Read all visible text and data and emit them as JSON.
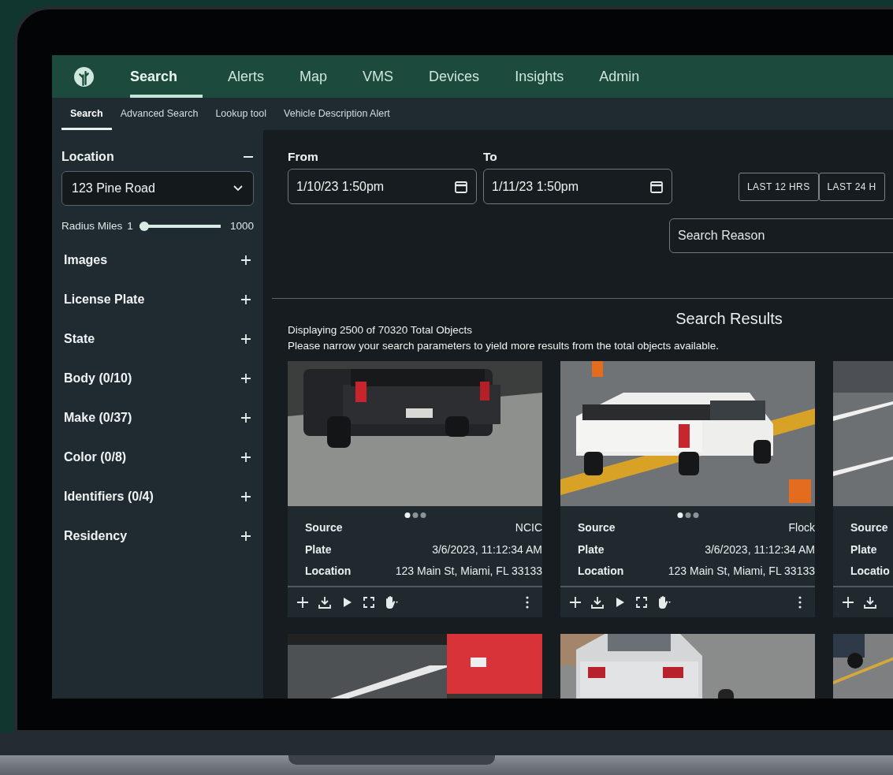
{
  "nav": {
    "tabs": [
      {
        "label": "Search",
        "selected": true
      },
      {
        "label": "Alerts",
        "selected": false
      },
      {
        "label": "Map",
        "selected": false
      },
      {
        "label": "VMS",
        "selected": false
      },
      {
        "label": "Devices",
        "selected": false
      },
      {
        "label": "Insights",
        "selected": false
      },
      {
        "label": "Admin",
        "selected": false
      }
    ]
  },
  "subnav": {
    "tabs": [
      {
        "label": "Search",
        "selected": true
      },
      {
        "label": "Advanced Search",
        "selected": false
      },
      {
        "label": "Lookup tool",
        "selected": false
      },
      {
        "label": "Vehicle Description Alert",
        "selected": false
      }
    ]
  },
  "sidebar": {
    "location": {
      "label": "Location",
      "expanded": true,
      "value": "123 Pine Road"
    },
    "radius": {
      "label": "Radius Miles",
      "min": "1",
      "max": "1000",
      "level": 0
    },
    "filters": [
      {
        "label": "Images",
        "expanded": false
      },
      {
        "label": "License Plate",
        "expanded": false
      },
      {
        "label": "State",
        "expanded": false
      },
      {
        "label": "Body (0/10)",
        "expanded": false
      },
      {
        "label": "Make (0/37)",
        "expanded": false
      },
      {
        "label": "Color (0/8)",
        "expanded": false
      },
      {
        "label": "Identifiers (0/4)",
        "expanded": false
      },
      {
        "label": "Residency",
        "expanded": false
      }
    ]
  },
  "dates": [
    {
      "label": "From",
      "value": "1/10/23 1:50pm"
    },
    {
      "label": "To",
      "value": "1/11/23 1:50pm"
    }
  ],
  "quick_ranges": [
    {
      "label": "LAST 12 HRS"
    },
    {
      "label": "LAST 24 H"
    }
  ],
  "search_reason": {
    "placeholder": "Search Reason"
  },
  "results": {
    "title": "Search Results",
    "summary": "Displaying 2500 of 70320 Total Objects",
    "hint": "Please narrow your search parameters to yield more results from the total objects available.",
    "cards": [
      {
        "dots": [
          {
            "selected": true
          },
          {
            "selected": false
          },
          {
            "selected": false
          }
        ],
        "rows": [
          {
            "label": "Source",
            "value": "NCIC"
          },
          {
            "label": "Plate",
            "value": "3/6/2023, 11:12:34 AM"
          },
          {
            "label": "Location",
            "value": "123 Main St, Miami, FL 33133"
          }
        ],
        "tools": [
          {
            "kind": "add"
          },
          {
            "kind": "download"
          },
          {
            "kind": "play"
          },
          {
            "kind": "expand"
          },
          {
            "kind": "hand"
          },
          {
            "kind": "more"
          }
        ]
      },
      {
        "dots": [
          {
            "selected": true
          },
          {
            "selected": false
          },
          {
            "selected": false
          }
        ],
        "rows": [
          {
            "label": "Source",
            "value": "Flock"
          },
          {
            "label": "Plate",
            "value": "3/6/2023, 11:12:34 AM"
          },
          {
            "label": "Location",
            "value": "123 Main St, Miami, FL 33133"
          }
        ],
        "tools": [
          {
            "kind": "add"
          },
          {
            "kind": "download"
          },
          {
            "kind": "play"
          },
          {
            "kind": "expand"
          },
          {
            "kind": "hand"
          },
          {
            "kind": "more"
          }
        ]
      },
      {
        "rows": [
          {
            "label": "Source"
          },
          {
            "label": "Plate"
          },
          {
            "label": "Locatio"
          }
        ],
        "tools": [
          {
            "kind": "add"
          },
          {
            "kind": "download"
          }
        ]
      }
    ]
  }
}
